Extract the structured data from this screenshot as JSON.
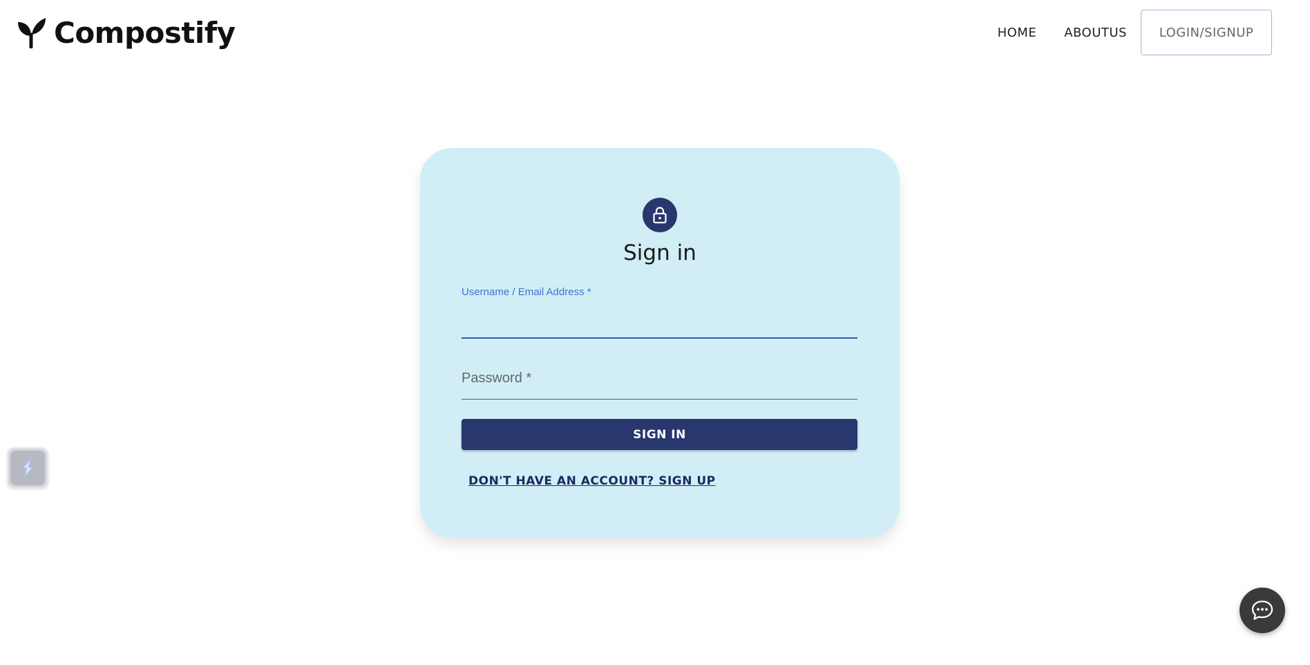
{
  "header": {
    "brand_name": "Compostify",
    "brand_logo_icon": "sprout-icon",
    "nav": {
      "home": "HOME",
      "about": "ABOUTUS",
      "login": "LOGIN/SIGNUP"
    }
  },
  "signin_card": {
    "icon": "lock-icon",
    "title": "Sign in",
    "username_label": "Username / Email Address *",
    "username_value": "",
    "password_label": "Password *",
    "password_value": "",
    "submit_label": "SIGN IN",
    "signup_link": "DON'T HAVE AN ACCOUNT? SIGN UP"
  },
  "widgets": {
    "side_widget_icon": "extension-icon",
    "chat_icon": "chat-bubble-icon"
  },
  "colors": {
    "card_bg": "#d1eef7",
    "primary": "#28386e",
    "focus_label": "#3f73c6",
    "login_border": "#9cb4d8"
  }
}
